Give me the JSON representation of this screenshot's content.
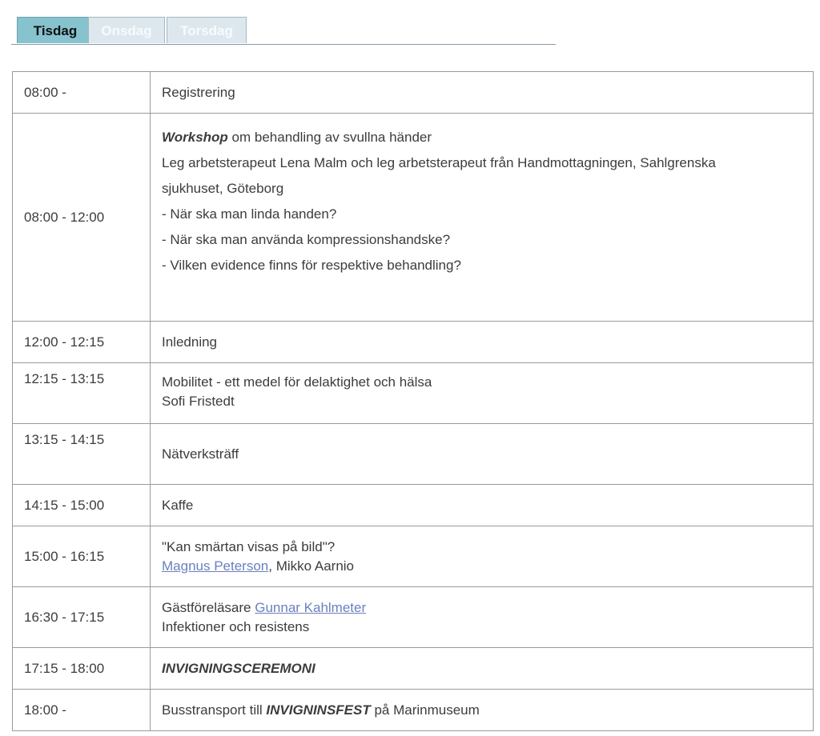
{
  "tabs": [
    {
      "label": "Tisdag",
      "active": true
    },
    {
      "label": "Onsdag",
      "active": false
    },
    {
      "label": "Torsdag",
      "active": false
    }
  ],
  "schedule": {
    "rows": [
      {
        "time": "08:00 -",
        "activity": "Registrering"
      },
      {
        "time": "08:00 - 12:00",
        "workshop_label": "Workshop",
        "workshop_title": " om behandling av svullna händer",
        "speakers_line1": "Leg arbetsterapeut Lena Malm och leg arbetsterapeut från Handmottagningen, Sahlgrenska",
        "speakers_line2": "sjukhuset, Göteborg",
        "q1": "- När ska man linda handen?",
        "q2": "- När ska man använda kompressionshandske?",
        "q3": "- Vilken evidence finns för respektive behandling?"
      },
      {
        "time": "12:00 - 12:15",
        "activity": "Inledning"
      },
      {
        "time": "12:15 - 13:15",
        "title": "Mobilitet - ett medel för delaktighet och hälsa",
        "speaker": "Sofi Fristedt"
      },
      {
        "time": "13:15 - 14:15",
        "activity": "Nätverksträff"
      },
      {
        "time": "14:15 - 15:00",
        "activity": "Kaffe"
      },
      {
        "time": "15:00 - 16:15",
        "title": "\"Kan smärtan visas på bild\"?",
        "speaker_link": "Magnus Peterson",
        "speaker_rest": ", Mikko Aarnio"
      },
      {
        "time": "16:30 - 17:15",
        "prefix": "Gästföreläsare ",
        "speaker_link": "Gunnar Kahlmeter",
        "subtitle": "Infektioner och resistens"
      },
      {
        "time": "17:15 - 18:00",
        "activity": "INVIGNINGSCEREMONI"
      },
      {
        "time": "18:00 -",
        "prefix": "Busstransport till ",
        "event": "INVIGNINSFEST",
        "suffix": " på Marinmuseum"
      }
    ]
  }
}
